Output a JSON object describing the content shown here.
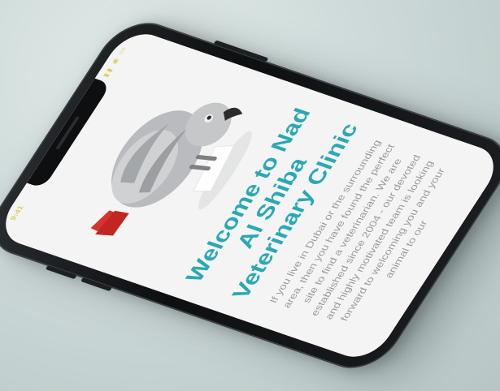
{
  "status_bar": {
    "time": "9:41",
    "icons": "▮▮ ◉ ▭"
  },
  "hero": {
    "image_alt": "African grey parrot",
    "title": "Welcome to Nad Al Shiba Veterinary Clinic",
    "body": "If you live in Dubai or the surrounding area, then you have found the perfect site to find a veterinarian. We are established since 2004 - our devoted and highly motivated team is looking forward to welcoming you and your animal to our"
  },
  "colors": {
    "accent": "#2aa9b4",
    "body_text": "#9a9c9c",
    "screen_bg": "#f3f4f3",
    "phone_frame": "#0d0f11"
  }
}
